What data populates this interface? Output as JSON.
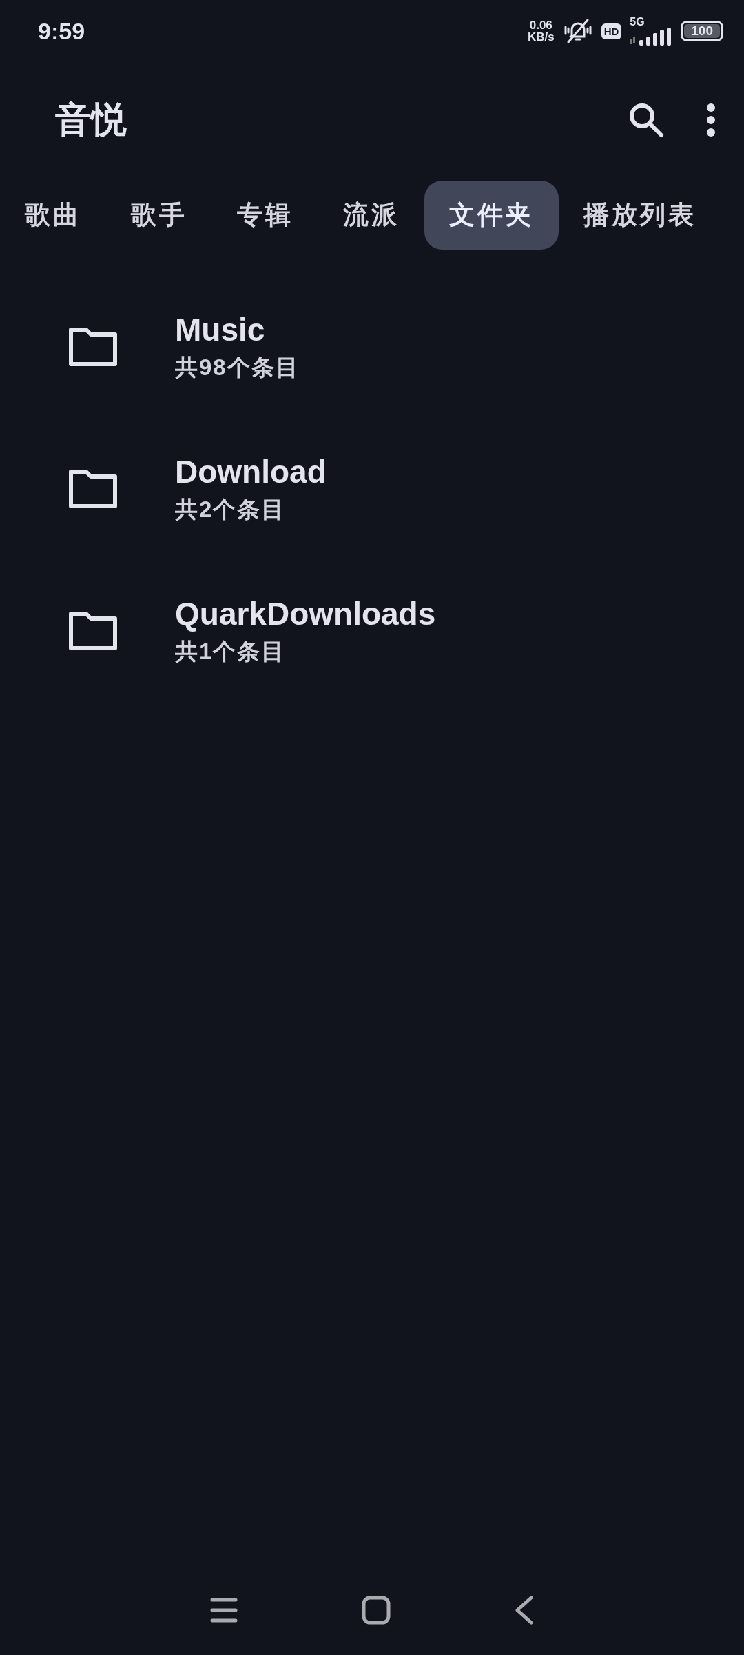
{
  "status_bar": {
    "time": "9:59",
    "net_speed_value": "0.06",
    "net_speed_unit": "KB/s",
    "hd_badge": "HD",
    "network": "5G",
    "battery": "100"
  },
  "app_bar": {
    "title": "音悦"
  },
  "tabs": [
    {
      "label": "歌曲",
      "selected": false
    },
    {
      "label": "歌手",
      "selected": false
    },
    {
      "label": "专辑",
      "selected": false
    },
    {
      "label": "流派",
      "selected": false
    },
    {
      "label": "文件夹",
      "selected": true
    },
    {
      "label": "播放列表",
      "selected": false
    }
  ],
  "folders": [
    {
      "name": "Music",
      "count": "共98个条目"
    },
    {
      "name": "Download",
      "count": "共2个条目"
    },
    {
      "name": "QuarkDownloads",
      "count": "共1个条目"
    }
  ]
}
